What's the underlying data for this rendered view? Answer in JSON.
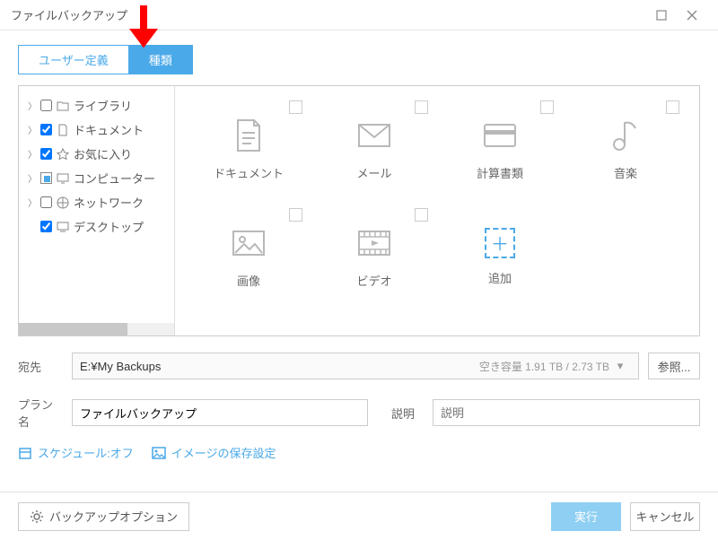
{
  "window": {
    "title": "ファイルバックアップ"
  },
  "tabs": {
    "user_defined": "ユーザー定義",
    "type": "種類"
  },
  "tree": {
    "items": [
      {
        "label": "ライブラリ",
        "icon": "folder",
        "checked": false,
        "half": false
      },
      {
        "label": "ドキュメント",
        "icon": "doc",
        "checked": true,
        "half": false
      },
      {
        "label": "お気に入り",
        "icon": "star",
        "checked": true,
        "half": false
      },
      {
        "label": "コンピューター",
        "icon": "computer",
        "checked": false,
        "half": true
      },
      {
        "label": "ネットワーク",
        "icon": "network",
        "checked": false,
        "half": false
      },
      {
        "label": "デスクトップ",
        "icon": "desktop",
        "checked": true,
        "half": false
      }
    ]
  },
  "categories": {
    "document": "ドキュメント",
    "mail": "メール",
    "finance": "計算書類",
    "music": "音楽",
    "image": "画像",
    "video": "ビデオ",
    "add": "追加"
  },
  "destination": {
    "label": "宛先",
    "path": "E:¥My Backups",
    "space": "空き容量 1.91 TB / 2.73 TB",
    "browse": "参照..."
  },
  "plan": {
    "label": "プラン名",
    "value": "ファイルバックアップ"
  },
  "description": {
    "label": "説明",
    "placeholder": "説明"
  },
  "links": {
    "schedule": "スケジュール:オフ",
    "image_settings": "イメージの保存設定"
  },
  "footer": {
    "options": "バックアップオプション",
    "run": "実行",
    "cancel": "キャンセル"
  }
}
